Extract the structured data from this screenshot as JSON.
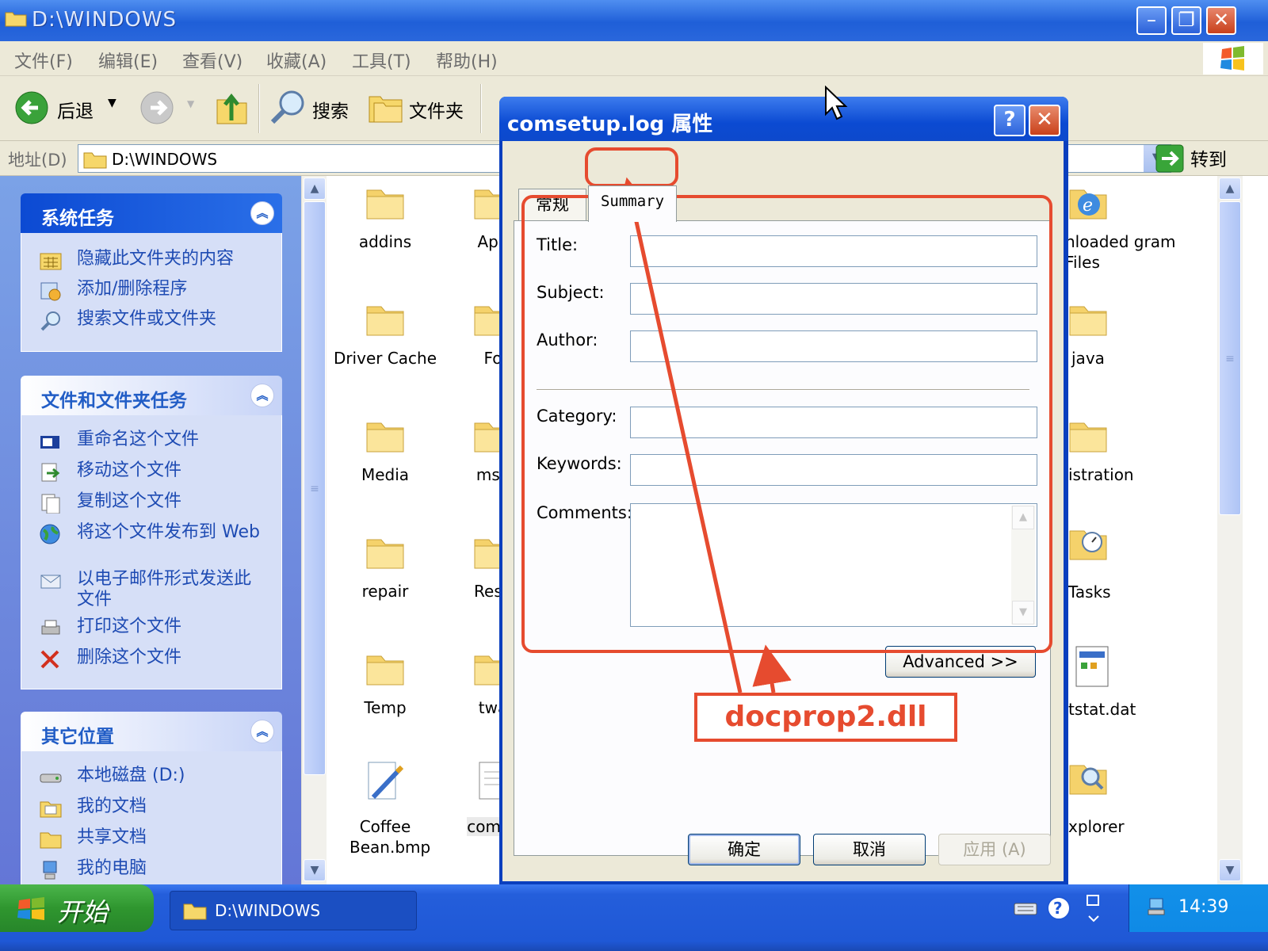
{
  "window": {
    "title": "D:\\WINDOWS"
  },
  "menu": [
    "文件(F)",
    "编辑(E)",
    "查看(V)",
    "收藏(A)",
    "工具(T)",
    "帮助(H)"
  ],
  "toolbar": {
    "back": "后退",
    "search": "搜索",
    "folders": "文件夹"
  },
  "address": {
    "label": "地址(D)",
    "value": "D:\\WINDOWS",
    "go": "转到"
  },
  "panels": {
    "system": {
      "title": "系统任务",
      "items": [
        "隐藏此文件夹的内容",
        "添加/删除程序",
        "搜索文件或文件夹"
      ]
    },
    "file": {
      "title": "文件和文件夹任务",
      "items": [
        "重命名这个文件",
        "移动这个文件",
        "复制这个文件",
        "将这个文件发布到 Web",
        "以电子邮件形式发送此文件",
        "打印这个文件",
        "删除这个文件"
      ]
    },
    "other": {
      "title": "其它位置",
      "items": [
        "本地磁盘 (D:)",
        "我的文档",
        "共享文档",
        "我的电脑"
      ]
    }
  },
  "files": {
    "col1": [
      "addins",
      "Driver Cache",
      "Media",
      "repair",
      "Temp",
      "Coffee Bean.bmp"
    ],
    "col2": [
      "App",
      "Fo",
      "msa",
      "Reso",
      "twa",
      "comse"
    ],
    "col3": [
      "nloaded gram Files",
      "java",
      "istration",
      "Tasks",
      "tstat.dat",
      "xplorer"
    ]
  },
  "dialog": {
    "title": "comsetup.log 属性",
    "tabs": [
      "常规",
      "Summary"
    ],
    "fields": [
      "Title:",
      "Subject:",
      "Author:",
      "Category:",
      "Keywords:",
      "Comments:"
    ],
    "advanced": "Advanced >>",
    "ok": "确定",
    "cancel": "取消",
    "apply": "应用 (A)"
  },
  "annotation": {
    "label": "docprop2.dll",
    "color": "#e64b2f"
  },
  "taskbar": {
    "start": "开始",
    "task": "D:\\WINDOWS",
    "clock": "14:39"
  }
}
